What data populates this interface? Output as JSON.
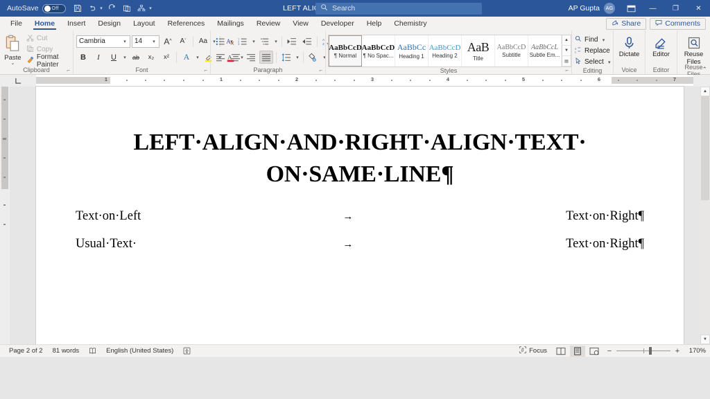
{
  "titlebar": {
    "autosave_label": "AutoSave",
    "autosave_state": "Off",
    "document_title": "LEFT ALIGN AND RIGHT ALIGN TEXT...",
    "title_caret": "▾",
    "search_placeholder": "Search",
    "search_icon": "search-icon",
    "user_name": "AP Gupta",
    "user_initials": "AG",
    "qat": [
      {
        "name": "save",
        "glyph": "🖫"
      },
      {
        "name": "undo",
        "glyph": "↺"
      },
      {
        "name": "redo",
        "glyph": "↻"
      },
      {
        "name": "repeat",
        "glyph": "⎘"
      },
      {
        "name": "organization-chart",
        "glyph": "⛬"
      },
      {
        "name": "customize-qat",
        "glyph": "▾"
      }
    ],
    "window_controls": {
      "ribbon_display": "⊡",
      "minimize": "—",
      "restore": "❐",
      "close": "✕"
    }
  },
  "tabs": [
    {
      "label": "File",
      "active": false
    },
    {
      "label": "Home",
      "active": true
    },
    {
      "label": "Insert",
      "active": false
    },
    {
      "label": "Design",
      "active": false
    },
    {
      "label": "Layout",
      "active": false
    },
    {
      "label": "References",
      "active": false
    },
    {
      "label": "Mailings",
      "active": false
    },
    {
      "label": "Review",
      "active": false
    },
    {
      "label": "View",
      "active": false
    },
    {
      "label": "Developer",
      "active": false
    },
    {
      "label": "Help",
      "active": false
    },
    {
      "label": "Chemistry",
      "active": false
    }
  ],
  "tabstrip_right": {
    "share_label": "Share",
    "share_icon": "share-icon",
    "comments_label": "Comments",
    "comments_icon": "comment-icon"
  },
  "ribbon": {
    "clipboard": {
      "group_label": "Clipboard",
      "paste_label": "Paste",
      "paste_caret": "⌄",
      "cut_label": "Cut",
      "copy_label": "Copy",
      "format_painter_label": "Format Painter"
    },
    "font": {
      "group_label": "Font",
      "font_name": "Cambria",
      "font_size": "14",
      "grow_font": "A",
      "shrink_font": "A",
      "change_case": "Aa",
      "clear_formatting": "A",
      "bold": "B",
      "italic": "I",
      "underline": "U",
      "strikethrough": "ab",
      "subscript": "x₂",
      "superscript": "x²",
      "text_effects": "A",
      "highlight": "✐",
      "font_color": "A"
    },
    "paragraph": {
      "group_label": "Paragraph",
      "bullets": "☰",
      "numbering": "☰",
      "multilevel": "☰",
      "decrease_indent": "⇤",
      "increase_indent": "⇥",
      "sort": "↓",
      "show_marks": "¶",
      "align_left": "≡",
      "align_center": "≡",
      "align_right": "≡",
      "justify": "≡",
      "line_spacing": "↕",
      "shading": "▲",
      "borders": "⊞"
    },
    "styles": {
      "group_label": "Styles",
      "items": [
        {
          "preview": "AaBbCcD",
          "name": "¶ Normal",
          "selected": true
        },
        {
          "preview": "AaBbCcD",
          "name": "¶ No Spac...",
          "selected": false
        },
        {
          "preview": "AaBbCc",
          "name": "Heading 1",
          "selected": false
        },
        {
          "preview": "AaBbCcD",
          "name": "Heading 2",
          "selected": false
        },
        {
          "preview": "AaB",
          "name": "Title",
          "selected": false
        },
        {
          "preview": "AaBbCcD",
          "name": "Subtitle",
          "selected": false
        },
        {
          "preview": "AaBbCcL",
          "name": "Subtle Em...",
          "selected": false
        }
      ],
      "scroll_up": "▲",
      "scroll_down": "▼",
      "more": "▤"
    },
    "editing": {
      "group_label": "Editing",
      "find_label": "Find",
      "find_caret": "⌄",
      "replace_label": "Replace",
      "select_label": "Select",
      "select_caret": "⌄"
    },
    "voice": {
      "group_label": "Voice",
      "dictate_label": "Dictate",
      "dictate_icon": "microphone-icon"
    },
    "editor": {
      "group_label": "Editor",
      "editor_label": "Editor",
      "editor_icon": "editor-pen-icon"
    },
    "reuse": {
      "group_label": "Reuse Files",
      "reuse_label": "Reuse Files",
      "reuse_icon": "reuse-files-icon"
    },
    "collapse_caret": "⌃"
  },
  "ruler": {
    "numbers": [
      "1",
      "2",
      "3",
      "4",
      "5",
      "6",
      "7"
    ],
    "corner_icon": "tab-stop-icon"
  },
  "document": {
    "title_line_1": "LEFT·ALIGN·AND·RIGHT·ALIGN·TEXT·",
    "title_line_2": "ON·SAME·LINE¶",
    "lines": [
      {
        "left": "Text·on·Left",
        "arrow": "→",
        "right": "Text·on·Right¶"
      },
      {
        "left": "Usual·Text·",
        "arrow": "→",
        "right": "Text·on·Right¶"
      }
    ]
  },
  "statusbar": {
    "page_info": "Page 2 of 2",
    "word_count": "81 words",
    "proofing_icon": "proofing-icon",
    "language": "English (United States)",
    "accessibility_icon": "accessibility-icon",
    "focus_label": "Focus",
    "focus_icon": "focus-icon",
    "view_read": "▥",
    "view_print": "▤",
    "view_web": "▣",
    "zoom_out": "−",
    "zoom_in": "+",
    "zoom_level": "170%"
  }
}
